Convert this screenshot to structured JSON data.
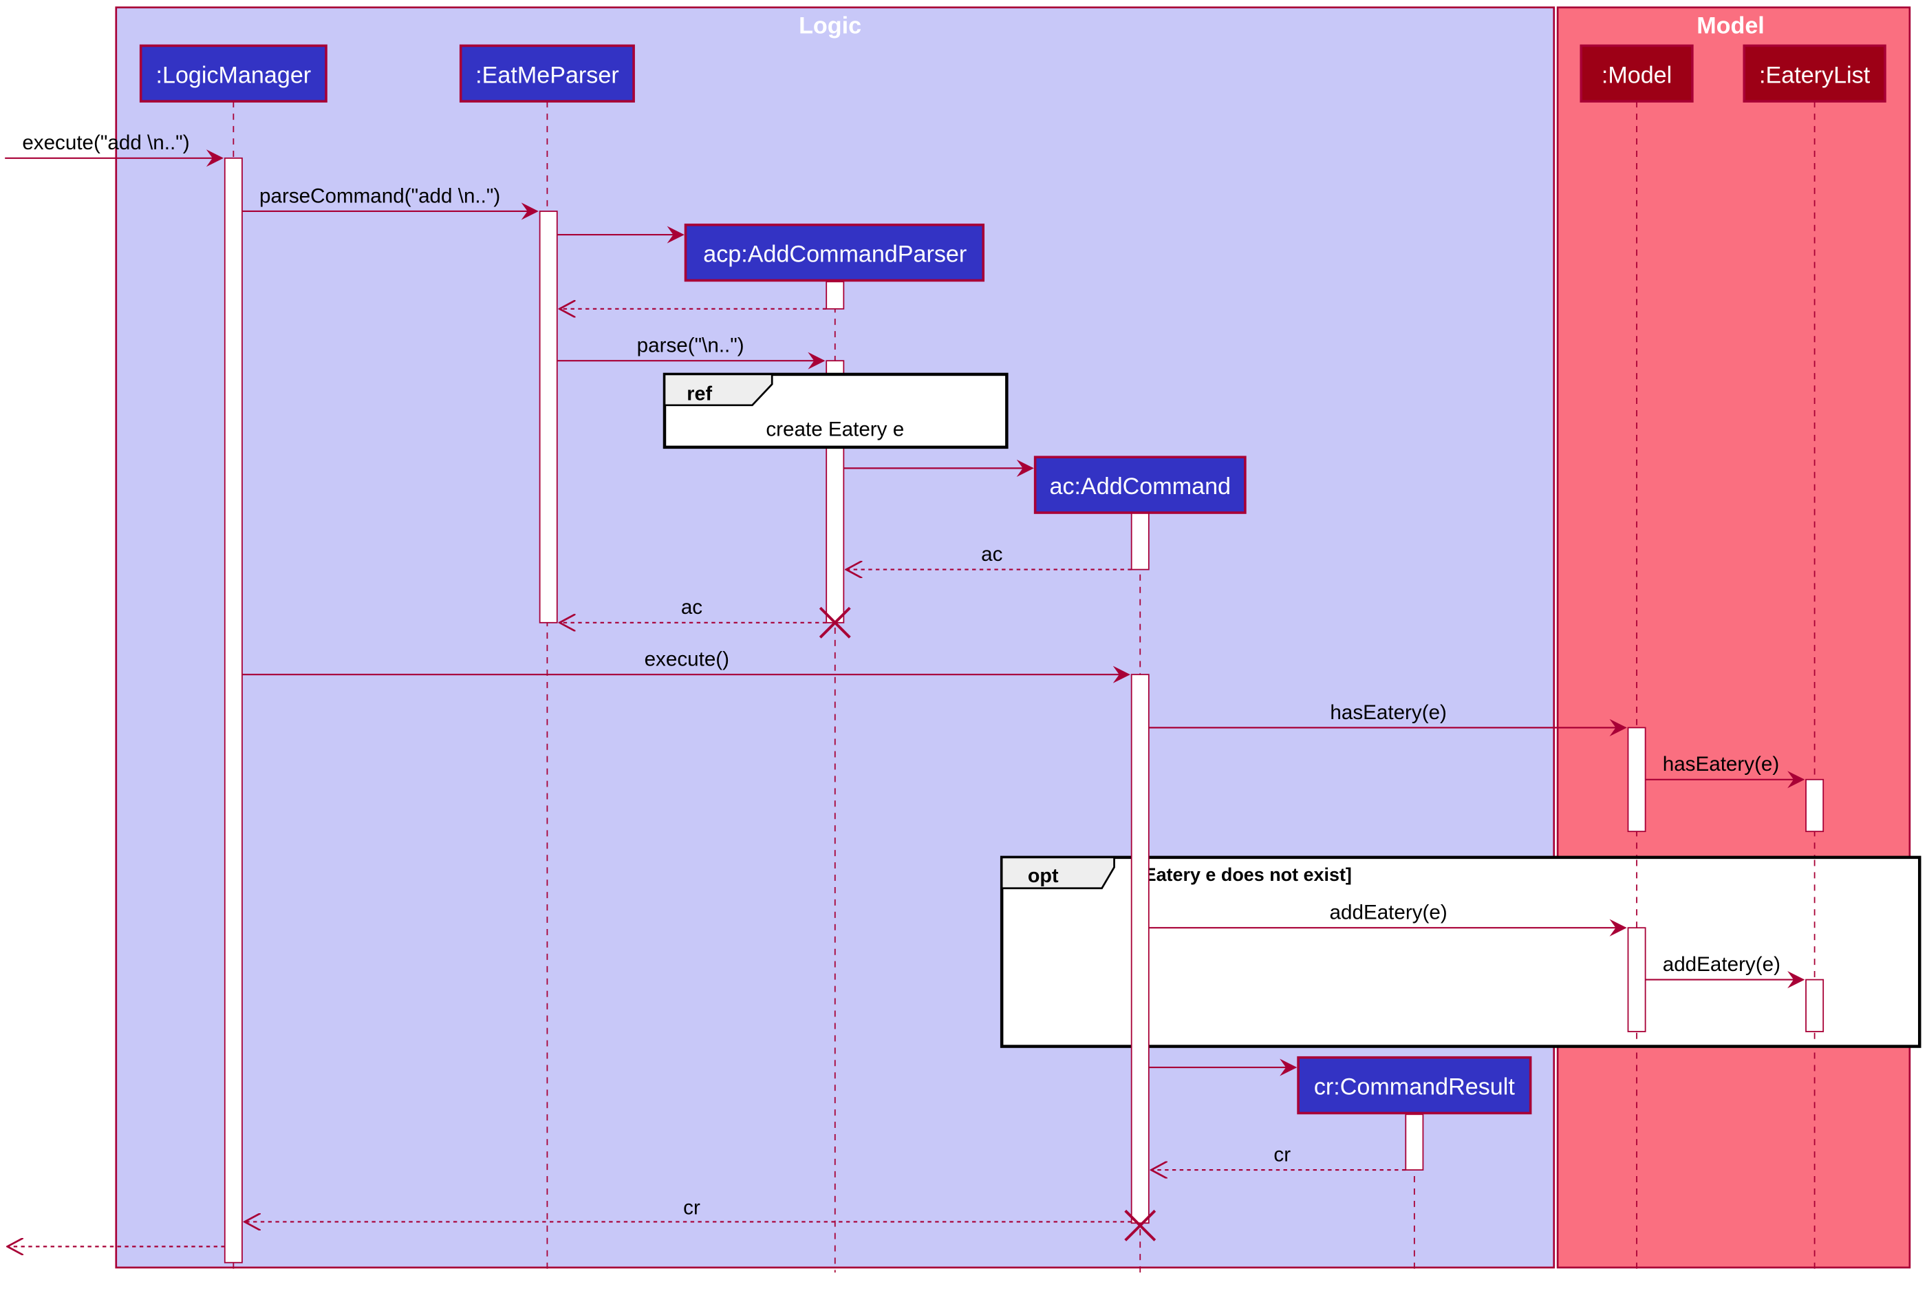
{
  "colors": {
    "logic_box_fill": "#C8C8F8",
    "model_box_fill": "#FA6F80",
    "border": "#A80036",
    "logic_participant_fill": "#3333C4",
    "model_participant_fill": "#9D0016",
    "activation_fill": "#ffffff",
    "fragment_border": "#000000",
    "fragment_tag_fill": "#EEEEEE",
    "participant_text": "#ffffff"
  },
  "boxes": [
    {
      "name": "logic",
      "title": "Logic"
    },
    {
      "name": "model",
      "title": "Model"
    }
  ],
  "participants": [
    {
      "id": "logicmanager",
      "label": ":LogicManager",
      "box": "logic"
    },
    {
      "id": "eatmeparser",
      "label": ":EatMeParser",
      "box": "logic"
    },
    {
      "id": "addcommandparser",
      "label": "acp:AddCommandParser",
      "box": "logic",
      "created": true
    },
    {
      "id": "addcommand",
      "label": "ac:AddCommand",
      "box": "logic",
      "created": true
    },
    {
      "id": "commandresult",
      "label": "cr:CommandResult",
      "box": "logic",
      "created": true
    },
    {
      "id": "model",
      "label": ":Model",
      "box": "model"
    },
    {
      "id": "eaterylist",
      "label": ":EateryList",
      "box": "model"
    }
  ],
  "messages": [
    {
      "from": "external",
      "to": "logicmanager",
      "label": "execute(\"add \\n..\")",
      "type": "sync"
    },
    {
      "from": "logicmanager",
      "to": "eatmeparser",
      "label": "parseCommand(\"add \\n..\")",
      "type": "sync"
    },
    {
      "from": "eatmeparser",
      "to": "addcommandparser",
      "label": "",
      "type": "create"
    },
    {
      "from": "addcommandparser",
      "to": "eatmeparser",
      "label": "",
      "type": "return"
    },
    {
      "from": "eatmeparser",
      "to": "addcommandparser",
      "label": "parse(\"\\n..\")",
      "type": "sync"
    },
    {
      "from": "addcommandparser",
      "to": "addcommand",
      "label": "",
      "type": "create"
    },
    {
      "from": "addcommand",
      "to": "addcommandparser",
      "label": "ac",
      "type": "return"
    },
    {
      "from": "addcommandparser",
      "to": "eatmeparser",
      "label": "ac",
      "type": "return"
    },
    {
      "from": "logicmanager",
      "to": "addcommand",
      "label": "execute()",
      "type": "sync"
    },
    {
      "from": "addcommand",
      "to": "model",
      "label": "hasEatery(e)",
      "type": "sync"
    },
    {
      "from": "model",
      "to": "eaterylist",
      "label": "hasEatery(e)",
      "type": "sync"
    },
    {
      "from": "addcommand",
      "to": "model",
      "label": "addEatery(e)",
      "type": "sync"
    },
    {
      "from": "model",
      "to": "eaterylist",
      "label": "addEatery(e)",
      "type": "sync"
    },
    {
      "from": "addcommand",
      "to": "commandresult",
      "label": "",
      "type": "create"
    },
    {
      "from": "commandresult",
      "to": "addcommand",
      "label": "cr",
      "type": "return"
    },
    {
      "from": "addcommand",
      "to": "logicmanager",
      "label": "cr",
      "type": "return"
    },
    {
      "from": "logicmanager",
      "to": "external",
      "label": "",
      "type": "return"
    }
  ],
  "fragments": [
    {
      "kind": "ref",
      "tag": "ref",
      "text": "create Eatery e"
    },
    {
      "kind": "opt",
      "tag": "opt",
      "condition": "[Eatery e does not exist]"
    }
  ],
  "destroyed": [
    "addcommandparser",
    "addcommand"
  ]
}
